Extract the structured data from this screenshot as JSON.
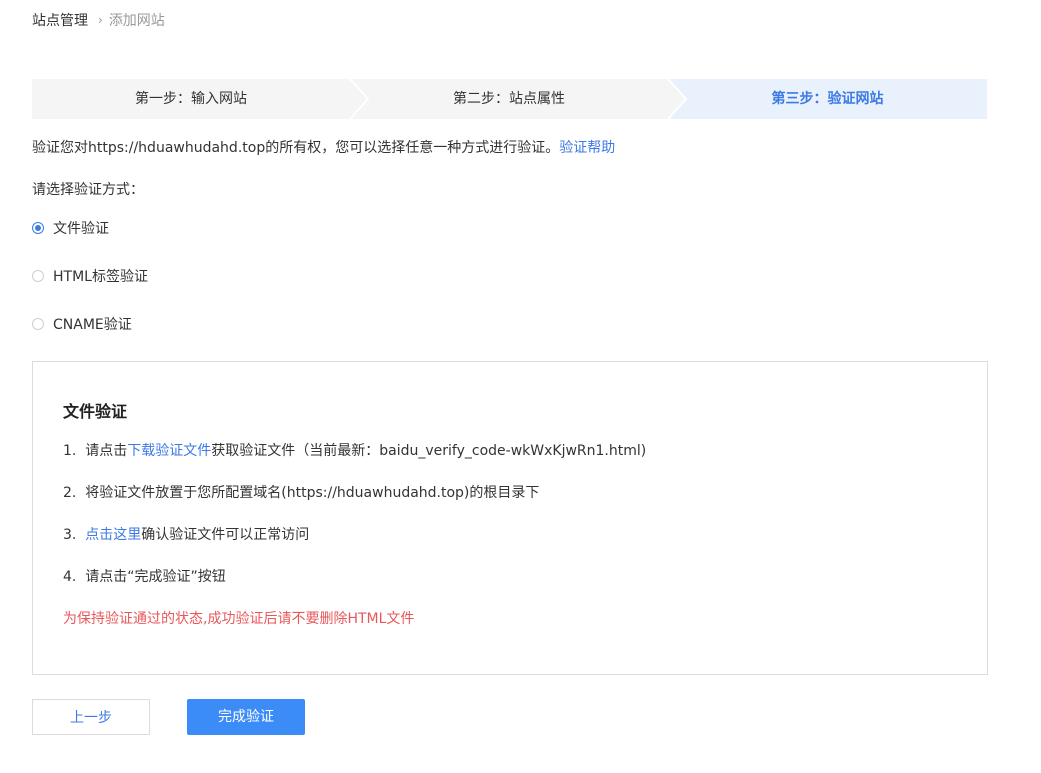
{
  "breadcrumb": {
    "root": "站点管理",
    "separator": "›",
    "current": "添加网站"
  },
  "steps": [
    {
      "label": "第一步：输入网站",
      "state": "done"
    },
    {
      "label": "第二步：站点属性",
      "state": "done"
    },
    {
      "label": "第三步：验证网站",
      "state": "active"
    }
  ],
  "intro": {
    "text": "验证您对https://hduawhudahd.top的所有权，您可以选择任意一种方式进行验证。",
    "help_link": "验证帮助"
  },
  "choose_label": "请选择验证方式：",
  "methods": [
    {
      "label": "文件验证",
      "checked": true
    },
    {
      "label": "HTML标签验证",
      "checked": false
    },
    {
      "label": "CNAME验证",
      "checked": false
    }
  ],
  "panel": {
    "title": "文件验证",
    "step1": {
      "num": "1.",
      "pre": "请点击",
      "link": "下载验证文件",
      "post": "获取验证文件（当前最新：baidu_verify_code-wkWxKjwRn1.html)"
    },
    "step2": {
      "num": "2.",
      "text": "将验证文件放置于您所配置域名(https://hduawhudahd.top)的根目录下"
    },
    "step3": {
      "num": "3.",
      "link": "点击这里",
      "post": "确认验证文件可以正常访问"
    },
    "step4": {
      "num": "4.",
      "text": "请点击“完成验证”按钮"
    },
    "warning": "为保持验证通过的状态,成功验证后请不要删除HTML文件"
  },
  "buttons": {
    "prev": "上一步",
    "done": "完成验证"
  },
  "colors": {
    "accent": "#3c7ae4",
    "primary_button": "#3c8cf7",
    "warning": "#e8585a",
    "step_bg": "#f5f5f5",
    "step_active_bg": "#e9f1fc"
  }
}
